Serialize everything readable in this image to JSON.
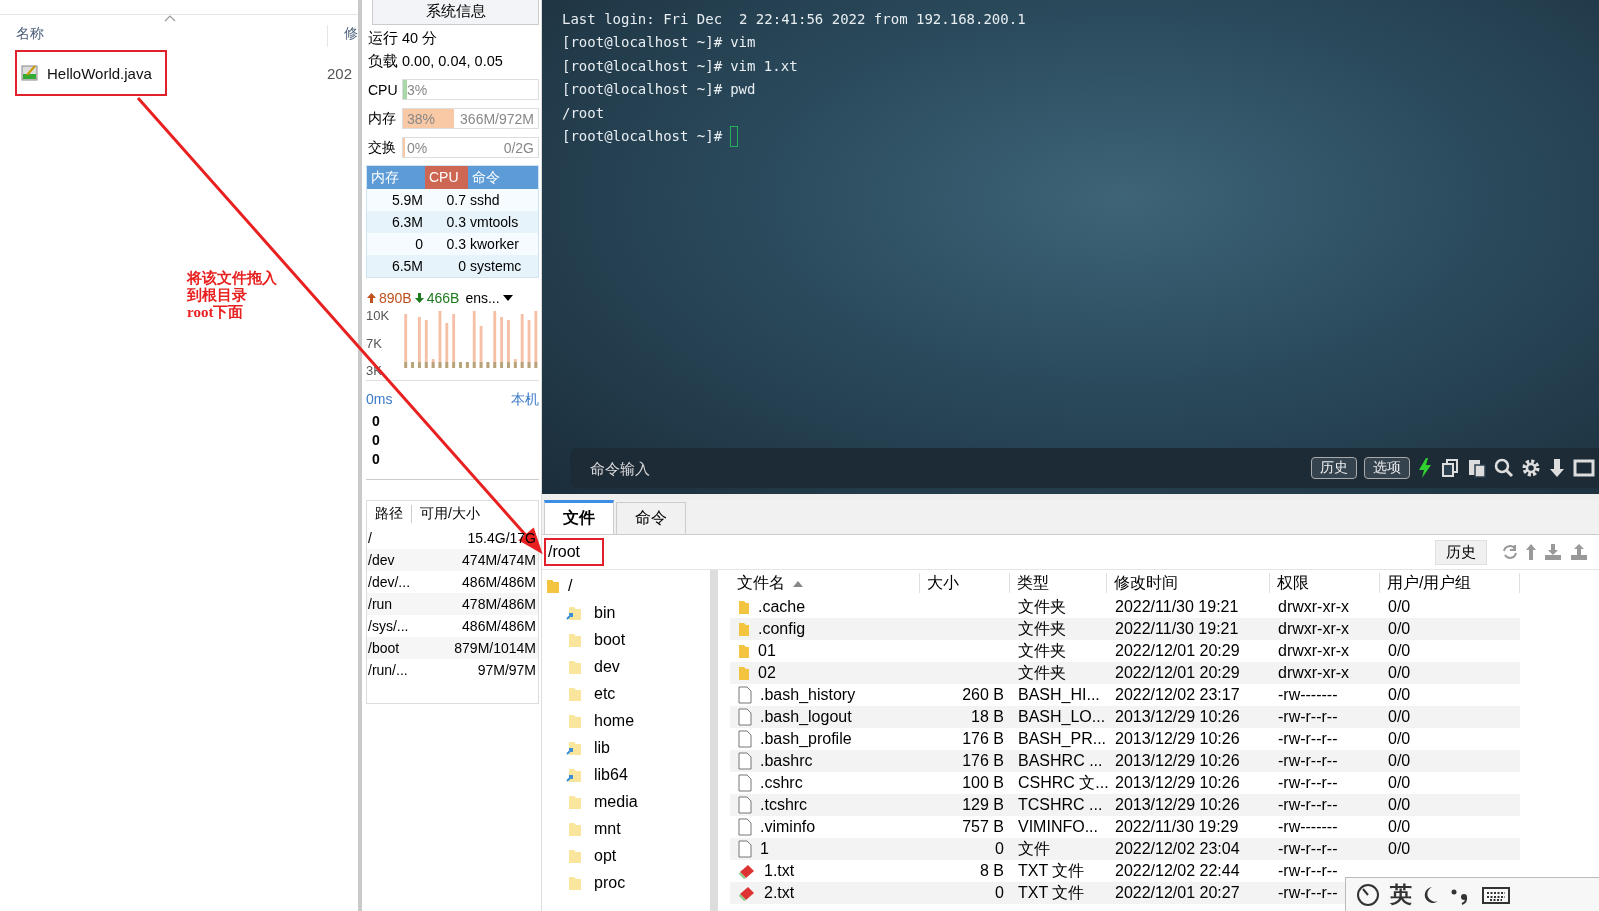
{
  "explorer": {
    "columns": [
      {
        "label": "名称",
        "sorted": true
      },
      {
        "label": "修"
      }
    ],
    "files": [
      {
        "name": "HelloWorld.java",
        "date": "202",
        "highlighted": true
      }
    ]
  },
  "annotation": {
    "lines": [
      "将该文件拖入",
      "到根目录",
      "root下面"
    ]
  },
  "sysinfo": {
    "title": "系统信息",
    "uptime": "运行 40 分",
    "load": "负载 0.00, 0.04, 0.05",
    "meters": [
      {
        "label": "CPU",
        "level": 0.03,
        "percent": "3%"
      },
      {
        "label": "内存",
        "level": 0.38,
        "percent": "38%",
        "detail": "366M/972M"
      },
      {
        "label": "交换",
        "level": 0,
        "percent": "0%",
        "detail": "0/2G"
      }
    ],
    "process_columns": [
      {
        "label": "内存",
        "sorted": false
      },
      {
        "label": "CPU",
        "sorted": true
      },
      {
        "label": "命令",
        "sorted": false
      }
    ],
    "processes": [
      {
        "mem": "5.9M",
        "cpu": "0.7",
        "cmd": "sshd"
      },
      {
        "mem": "6.3M",
        "cpu": "0.3",
        "cmd": "vmtools"
      },
      {
        "mem": "0",
        "cpu": "0.3",
        "cmd": "kworker"
      },
      {
        "mem": "6.5M",
        "cpu": "0",
        "cmd": "systemc"
      }
    ],
    "network": {
      "up": "890B",
      "down": "466B",
      "interface": "ens...",
      "ticks": [
        "10K",
        "7K",
        "3K"
      ]
    },
    "latency": {
      "value": "0ms",
      "host": "本机",
      "readings": [
        "0",
        "0",
        "0"
      ]
    },
    "disk_columns": [
      "路径",
      "可用/大小"
    ],
    "disks": [
      {
        "path": "/",
        "size": "15.4G/17G"
      },
      {
        "path": "/dev",
        "size": "474M/474M"
      },
      {
        "path": "/dev/...",
        "size": "486M/486M"
      },
      {
        "path": "/run",
        "size": "478M/486M"
      },
      {
        "path": "/sys/...",
        "size": "486M/486M"
      },
      {
        "path": "/boot",
        "size": "879M/1014M"
      },
      {
        "path": "/run/...",
        "size": "97M/97M"
      }
    ]
  },
  "terminal": {
    "lines": [
      {
        "text": "Last login: Fri Dec  2 22:41:56 2022 from 192.168.200.1"
      },
      {
        "prompt": "[root@localhost ~]#",
        "text": "vim"
      },
      {
        "prompt": "[root@localhost ~]#",
        "text": "vim 1.xt"
      },
      {
        "prompt": "[root@localhost ~]#",
        "text": "pwd"
      },
      {
        "text": "/root"
      },
      {
        "prompt": "[root@localhost ~]#",
        "cursor": true
      }
    ],
    "command_placeholder": "命令输入",
    "buttons": [
      "历史",
      "选项"
    ]
  },
  "files_panel": {
    "tabs": [
      {
        "label": "文件",
        "selected": true
      },
      {
        "label": "命令",
        "selected": false
      }
    ],
    "path": "/root",
    "history_button": "历史",
    "tree": [
      {
        "name": "/",
        "kind": "folder",
        "children": [
          {
            "name": "bin",
            "kind": "link"
          },
          {
            "name": "boot",
            "kind": "folder"
          },
          {
            "name": "dev",
            "kind": "folder"
          },
          {
            "name": "etc",
            "kind": "folder"
          },
          {
            "name": "home",
            "kind": "folder"
          },
          {
            "name": "lib",
            "kind": "link"
          },
          {
            "name": "lib64",
            "kind": "link"
          },
          {
            "name": "media",
            "kind": "folder"
          },
          {
            "name": "mnt",
            "kind": "folder"
          },
          {
            "name": "opt",
            "kind": "folder"
          },
          {
            "name": "proc",
            "kind": "folder"
          }
        ]
      }
    ],
    "columns": [
      {
        "label": "文件名",
        "sorted": true
      },
      {
        "label": "大小",
        "sorted": false
      },
      {
        "label": "类型",
        "sorted": false
      },
      {
        "label": "修改时间",
        "sorted": false
      },
      {
        "label": "权限",
        "sorted": false
      },
      {
        "label": "用户/用户组",
        "sorted": false
      }
    ],
    "rows": [
      {
        "kind": "folder",
        "name": ".cache",
        "type": "文件夹",
        "modified": "2022/11/30 19:21",
        "perm": "drwxr-xr-x",
        "owner": "0/0"
      },
      {
        "kind": "folder",
        "name": ".config",
        "type": "文件夹",
        "modified": "2022/11/30 19:21",
        "perm": "drwxr-xr-x",
        "owner": "0/0"
      },
      {
        "kind": "folder",
        "name": "01",
        "type": "文件夹",
        "modified": "2022/12/01 20:29",
        "perm": "drwxr-xr-x",
        "owner": "0/0"
      },
      {
        "kind": "folder",
        "name": "02",
        "type": "文件夹",
        "modified": "2022/12/01 20:29",
        "perm": "drwxr-xr-x",
        "owner": "0/0"
      },
      {
        "kind": "file",
        "name": ".bash_history",
        "size": "260 B",
        "type": "BASH_HI...",
        "modified": "2022/12/02 23:17",
        "perm": "-rw-------",
        "owner": "0/0"
      },
      {
        "kind": "file",
        "name": ".bash_logout",
        "size": "18 B",
        "type": "BASH_LO...",
        "modified": "2013/12/29 10:26",
        "perm": "-rw-r--r--",
        "owner": "0/0"
      },
      {
        "kind": "file",
        "name": ".bash_profile",
        "size": "176 B",
        "type": "BASH_PR...",
        "modified": "2013/12/29 10:26",
        "perm": "-rw-r--r--",
        "owner": "0/0"
      },
      {
        "kind": "file",
        "name": ".bashrc",
        "size": "176 B",
        "type": "BASHRC ...",
        "modified": "2013/12/29 10:26",
        "perm": "-rw-r--r--",
        "owner": "0/0"
      },
      {
        "kind": "file",
        "name": ".cshrc",
        "size": "100 B",
        "type": "CSHRC 文...",
        "modified": "2013/12/29 10:26",
        "perm": "-rw-r--r--",
        "owner": "0/0"
      },
      {
        "kind": "file",
        "name": ".tcshrc",
        "size": "129 B",
        "type": "TCSHRC ...",
        "modified": "2013/12/29 10:26",
        "perm": "-rw-r--r--",
        "owner": "0/0"
      },
      {
        "kind": "file",
        "name": ".viminfo",
        "size": "757 B",
        "type": "VIMINFO...",
        "modified": "2022/11/30 19:29",
        "perm": "-rw-------",
        "owner": "0/0"
      },
      {
        "kind": "file",
        "name": "1",
        "size": "0",
        "type": "文件",
        "modified": "2022/12/02 23:04",
        "perm": "-rw-r--r--",
        "owner": "0/0"
      },
      {
        "kind": "text",
        "name": "1.txt",
        "size": "8 B",
        "type": "TXT 文件",
        "modified": "2022/12/02 22:44",
        "perm": "-rw-r--r--"
      },
      {
        "kind": "text",
        "name": "2.txt",
        "size": "0",
        "type": "TXT 文件",
        "modified": "2022/12/01 20:27",
        "perm": "-rw-r--r--"
      }
    ]
  },
  "ime_bar": {
    "language": "英"
  }
}
